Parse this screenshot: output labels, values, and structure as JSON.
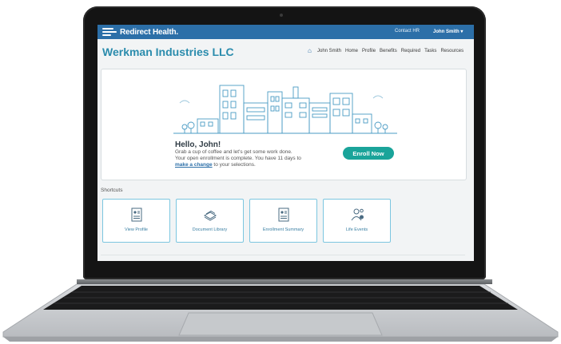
{
  "topbar": {
    "logo_text": "Redirect Health.",
    "contact_label": "Contact HR",
    "user_label": "John Smith ▾"
  },
  "header": {
    "company": "Werkman Industries LLC",
    "nav": [
      "John Smith",
      "Home",
      "Profile",
      "Benefits",
      "Required",
      "Tasks",
      "Resources"
    ]
  },
  "hero": {
    "greeting": "Hello, John!",
    "line1": "Grab a cup of coffee and let's get some work done.",
    "line2": "Your open enrollment is complete. You have 11 days to",
    "link_text": "make a change",
    "line3": " to your selections.",
    "enroll_label": "Enroll Now"
  },
  "shortcuts": {
    "title": "Shortcuts",
    "items": [
      {
        "label": "View Profile",
        "icon": "profile-document-icon"
      },
      {
        "label": "Document Library",
        "icon": "document-stack-icon"
      },
      {
        "label": "Enrollment Summary",
        "icon": "enrollment-document-icon"
      },
      {
        "label": "Life Events",
        "icon": "life-events-icon"
      }
    ]
  },
  "colors": {
    "brand_blue": "#2c6fa8",
    "company_teal": "#2b8cad",
    "enroll_green": "#1aa49a",
    "tile_border": "#7cc6e0"
  }
}
